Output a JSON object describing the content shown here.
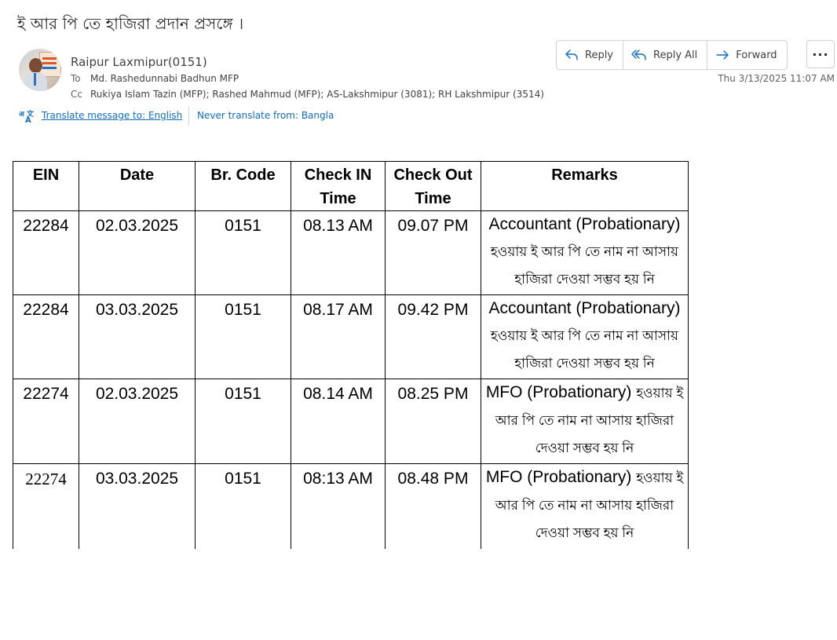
{
  "email": {
    "subject": "ই আর পি তে হাজিরা প্রদান প্রসঙ্গে ।",
    "sender": "Raipur Laxmipur(0151)",
    "to_label": "To",
    "to": "Md. Rashedunnabi Badhun MFP",
    "cc_label": "Cc",
    "cc": "Rukiya Islam Tazin (MFP); Rashed Mahmud (MFP); AS-Lakshmipur (3081); RH Lakshmipur (3514)",
    "date": "Thu 3/13/2025 11:07 AM"
  },
  "translate": {
    "link": "Translate message to: English",
    "never": "Never translate from: Bangla"
  },
  "actions": {
    "reply": "Reply",
    "reply_all": "Reply All",
    "forward": "Forward",
    "more": "···"
  },
  "table": {
    "headers": [
      "EIN",
      "Date",
      "Br. Code",
      "Check IN Time",
      "Check Out Time",
      "Remarks"
    ],
    "rows": [
      {
        "ein": "22284",
        "date": "02.03.2025",
        "code": "0151",
        "in": "08.13 AM",
        "out": "09.07 PM",
        "remark_en": "Accountant (Probationary)",
        "remark_bn": "হওয়ায় ই আর পি তে নাম না আসায় হাজিরা দেওয়া সম্ভব হয় নি"
      },
      {
        "ein": "22284",
        "date": "03.03.2025",
        "code": "0151",
        "in": "08.17 AM",
        "out": "09.42 PM",
        "remark_en": "Accountant (Probationary)",
        "remark_bn": "হওয়ায় ই আর পি তে নাম না আসায় হাজিরা দেওয়া সম্ভব হয় নি"
      },
      {
        "ein": "22274",
        "date": "02.03.2025",
        "code": "0151",
        "in": "08.14 AM",
        "out": "08.25 PM",
        "remark_en": "MFO (Probationary)",
        "remark_bn": "হওয়ায় ই আর পি তে নাম না আসায় হাজিরা দেওয়া সম্ভব হয় নি"
      },
      {
        "ein": "22274",
        "date": "03.03.2025",
        "code": "0151",
        "in": "08:13 AM",
        "out": "08.48 PM",
        "remark_en": "MFO (Probationary)",
        "remark_bn": "হওয়ায় ই আর পি তে নাম না আসায় হাজিরা দেওয়া সম্ভব হয় নি"
      }
    ]
  }
}
